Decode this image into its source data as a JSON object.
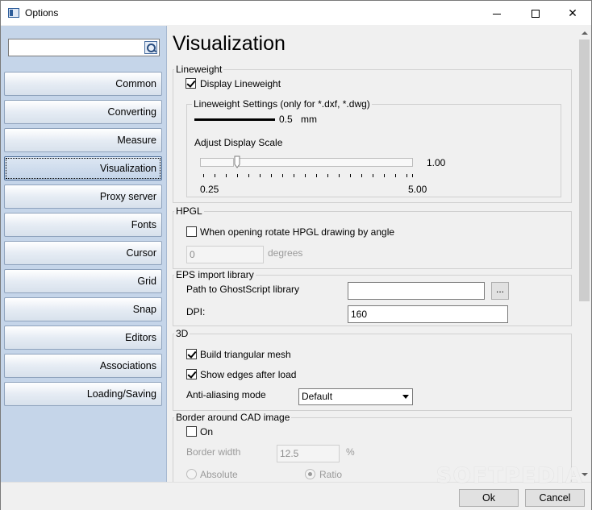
{
  "window": {
    "title": "Options",
    "icon": "app-window-icon"
  },
  "sidebar": {
    "search_placeholder": "",
    "items": [
      {
        "label": "Common"
      },
      {
        "label": "Converting"
      },
      {
        "label": "Measure"
      },
      {
        "label": "Visualization",
        "active": true
      },
      {
        "label": "Proxy server"
      },
      {
        "label": "Fonts"
      },
      {
        "label": "Cursor"
      },
      {
        "label": "Grid"
      },
      {
        "label": "Snap"
      },
      {
        "label": "Editors"
      },
      {
        "label": "Associations"
      },
      {
        "label": "Loading/Saving"
      }
    ]
  },
  "page": {
    "title": "Visualization"
  },
  "lineweight": {
    "group_title": "Lineweight",
    "display_label": "Display Lineweight",
    "display_checked": true,
    "settings_title": "Lineweight Settings (only for *.dxf, *.dwg)",
    "weight_value": "0.5",
    "weight_unit": "mm",
    "adjust_label": "Adjust Display Scale",
    "scale_value": "1.00",
    "scale_min": "0.25",
    "scale_max": "5.00"
  },
  "hpgl": {
    "group_title": "HPGL",
    "rotate_label": "When opening rotate HPGL drawing by angle",
    "rotate_checked": false,
    "angle_value": "0",
    "angle_unit": "degrees"
  },
  "eps": {
    "group_title": "EPS import library",
    "path_label": "Path to GhostScript library",
    "path_value": "",
    "browse_label": "...",
    "dpi_label": "DPI:",
    "dpi_value": "160"
  },
  "three_d": {
    "group_title": "3D",
    "mesh_label": "Build triangular mesh",
    "mesh_checked": true,
    "edges_label": "Show edges after load",
    "edges_checked": true,
    "aa_label": "Anti-aliasing mode",
    "aa_value": "Default"
  },
  "border": {
    "group_title": "Border around CAD image",
    "on_label": "On",
    "on_checked": false,
    "width_label": "Border width",
    "width_value": "12.5",
    "width_unit": "%",
    "absolute_label": "Absolute",
    "ratio_label": "Ratio"
  },
  "footer": {
    "ok_label": "Ok",
    "cancel_label": "Cancel"
  },
  "watermark": "SOFTPEDIA"
}
